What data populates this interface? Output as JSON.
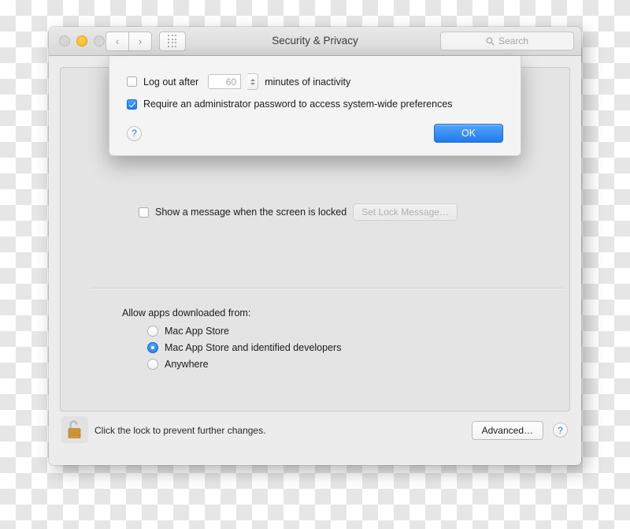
{
  "window": {
    "title": "Security & Privacy",
    "traffic_lights": [
      "close",
      "minimize",
      "zoom"
    ],
    "nav": {
      "back": "‹",
      "forward": "›"
    },
    "show_all_icon": "grid-icon",
    "search": {
      "placeholder": "Search",
      "value": "",
      "icon": "search-icon"
    }
  },
  "sheet": {
    "log_out": {
      "label": "Log out after",
      "checked": false,
      "minutes_value": "60",
      "suffix": "minutes of inactivity",
      "stepper_icon": "stepper-icon"
    },
    "require_admin": {
      "label": "Require an administrator password to access system-wide preferences",
      "checked": true
    },
    "help_label": "?",
    "ok_label": "OK"
  },
  "panel": {
    "lock_message": {
      "label": "Show a message when the screen is locked",
      "checked": false,
      "button_label": "Set Lock Message…",
      "button_disabled": true
    },
    "allow_apps": {
      "title": "Allow apps downloaded from:",
      "options": [
        {
          "label": "Mac App Store",
          "selected": false
        },
        {
          "label": "Mac App Store and identified developers",
          "selected": true
        },
        {
          "label": "Anywhere",
          "selected": false
        }
      ]
    }
  },
  "bottom": {
    "lock_icon": "unlocked-padlock-icon",
    "lock_caption": "Click the lock to prevent further changes.",
    "advanced_label": "Advanced…",
    "help_label": "?"
  },
  "colors": {
    "accent_blue": "#1f7aec",
    "titlebar": "#e1e1e1",
    "panel_bg": "#e4e4e4",
    "sheet_bg": "#f4f4f4",
    "lock_gold": "#d99a3e"
  }
}
